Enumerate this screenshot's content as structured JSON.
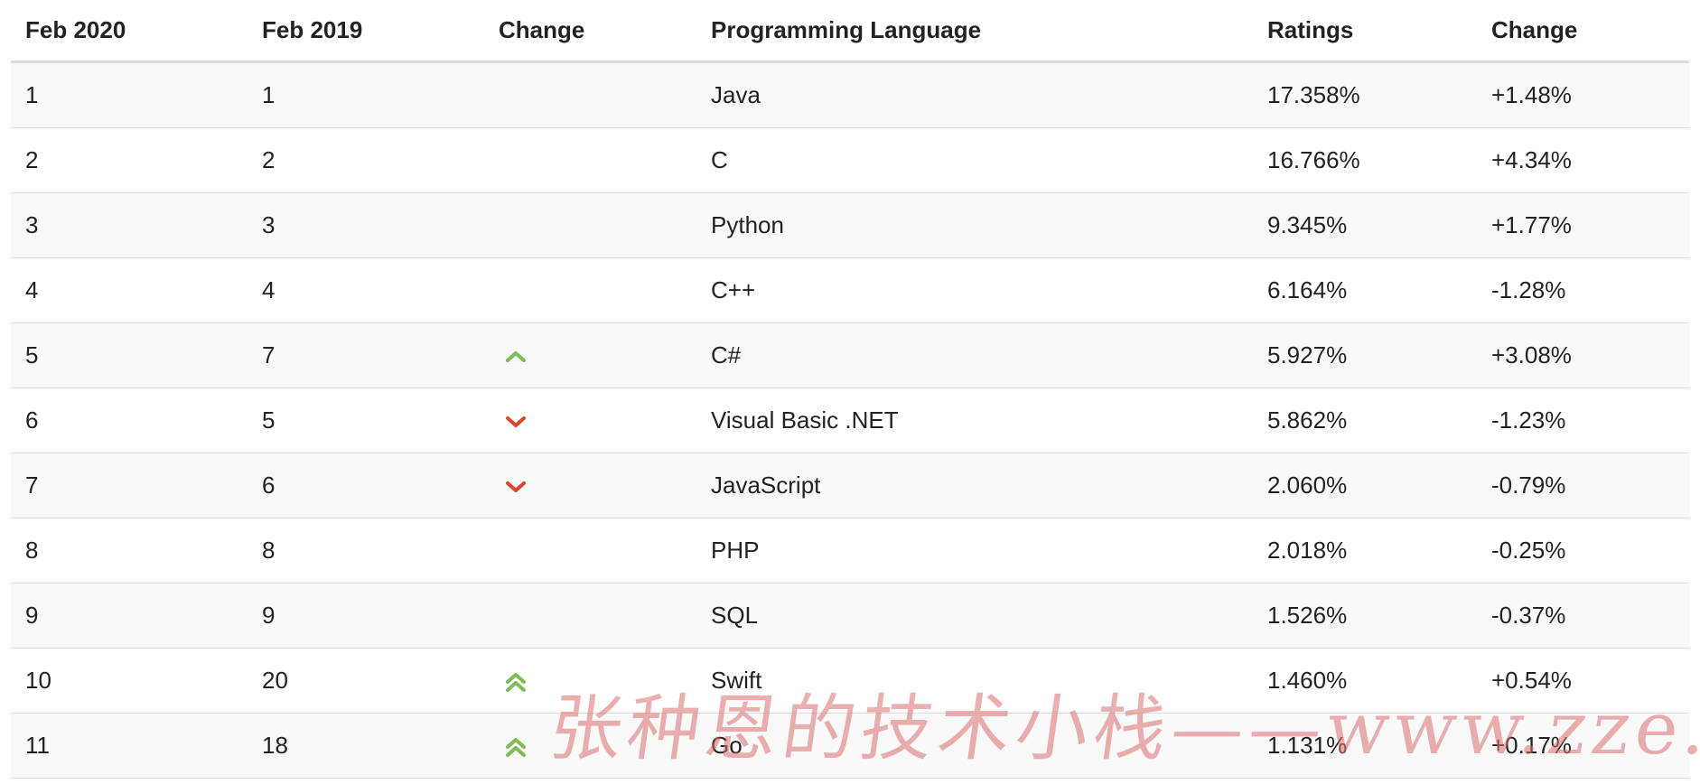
{
  "table": {
    "headers": {
      "rank_2020": "Feb 2020",
      "rank_2019": "Feb 2019",
      "change_arrow": "Change",
      "language": "Programming Language",
      "ratings": "Ratings",
      "change_pct": "Change"
    },
    "rows": [
      {
        "rank_2020": "1",
        "rank_2019": "1",
        "trend": "none",
        "language": "Java",
        "ratings": "17.358%",
        "change": "+1.48%"
      },
      {
        "rank_2020": "2",
        "rank_2019": "2",
        "trend": "none",
        "language": "C",
        "ratings": "16.766%",
        "change": "+4.34%"
      },
      {
        "rank_2020": "3",
        "rank_2019": "3",
        "trend": "none",
        "language": "Python",
        "ratings": "9.345%",
        "change": "+1.77%"
      },
      {
        "rank_2020": "4",
        "rank_2019": "4",
        "trend": "none",
        "language": "C++",
        "ratings": "6.164%",
        "change": "-1.28%"
      },
      {
        "rank_2020": "5",
        "rank_2019": "7",
        "trend": "up",
        "language": "C#",
        "ratings": "5.927%",
        "change": "+3.08%"
      },
      {
        "rank_2020": "6",
        "rank_2019": "5",
        "trend": "down",
        "language": "Visual Basic .NET",
        "ratings": "5.862%",
        "change": "-1.23%"
      },
      {
        "rank_2020": "7",
        "rank_2019": "6",
        "trend": "down",
        "language": "JavaScript",
        "ratings": "2.060%",
        "change": "-0.79%"
      },
      {
        "rank_2020": "8",
        "rank_2019": "8",
        "trend": "none",
        "language": "PHP",
        "ratings": "2.018%",
        "change": "-0.25%"
      },
      {
        "rank_2020": "9",
        "rank_2019": "9",
        "trend": "none",
        "language": "SQL",
        "ratings": "1.526%",
        "change": "-0.37%"
      },
      {
        "rank_2020": "10",
        "rank_2019": "20",
        "trend": "double-up",
        "language": "Swift",
        "ratings": "1.460%",
        "change": "+0.54%"
      },
      {
        "rank_2020": "11",
        "rank_2019": "18",
        "trend": "double-up",
        "language": "Go",
        "ratings": "1.131%",
        "change": "+0.17%"
      }
    ]
  },
  "icons": {
    "up": "chevron-up-icon",
    "down": "chevron-down-icon",
    "double-up": "double-chevron-up-icon"
  },
  "colors": {
    "up": "#7dbb5b",
    "down": "#d9472b",
    "row_stripe": "#f9f9f9",
    "border": "#dddddd",
    "watermark": "#da6e6e"
  },
  "watermark": "张种恩的技术小栈——www.zze.xyz"
}
